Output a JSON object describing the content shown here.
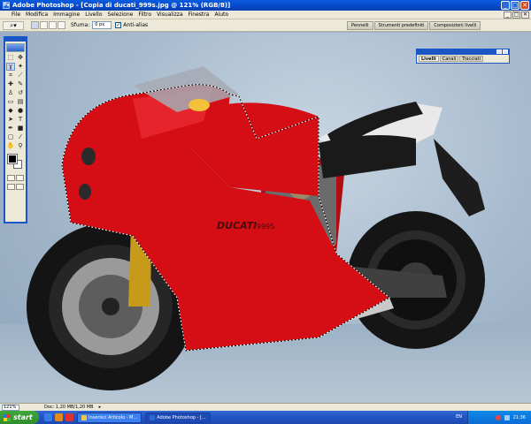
{
  "window": {
    "app_icon": "Ps",
    "title": "Adobe Photoshop - [Copia di ducati_999s.jpg @ 121% (RGB/8)]",
    "min": "_",
    "max": "□",
    "close": "✕"
  },
  "menu": [
    "File",
    "Modifica",
    "Immagine",
    "Livello",
    "Selezione",
    "Filtro",
    "Visualizza",
    "Finestra",
    "Aiuto"
  ],
  "options": {
    "feather_label": "Sfuma:",
    "feather_value": "0 px",
    "antialias_label": "Anti-alias",
    "antialias_checked": "✓",
    "wells": [
      "Pennelli",
      "Strumenti predefiniti",
      "Composizioni livelli"
    ]
  },
  "layers_palette": {
    "tabs": [
      "Livelli",
      "Canali",
      "Tracciati"
    ]
  },
  "image": {
    "brand_on_bike": "DUCATI",
    "model_on_bike": "999S"
  },
  "status": {
    "zoom": "121%",
    "doc": "Doc: 1,20 MB/1,20 MB",
    "arrow": "▸"
  },
  "taskbar": {
    "start": "start",
    "tasks": [
      "Inserisci Articolo - M...",
      "Adobe Photoshop - [..."
    ],
    "lang": "EN",
    "clock": "21:36"
  },
  "colors": {
    "titlebar": "#0648c8",
    "bike_red": "#d40e14",
    "chrome_bg": "#ece9d8"
  }
}
